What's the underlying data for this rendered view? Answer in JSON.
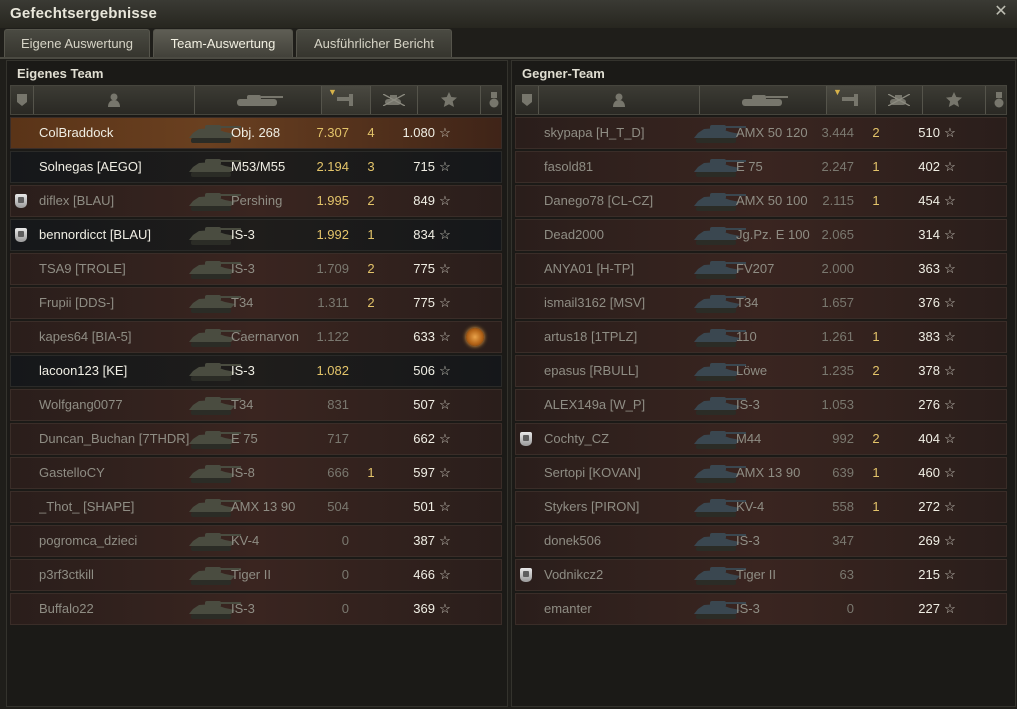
{
  "window": {
    "title": "Gefechtsergebnisse"
  },
  "tabs": [
    {
      "label": "Eigene Auswertung",
      "active": false
    },
    {
      "label": "Team-Auswertung",
      "active": true
    },
    {
      "label": "Ausführlicher Bericht",
      "active": false
    }
  ],
  "columns": [
    "platoon-icon",
    "player-icon",
    "vehicle-icon",
    "xp-icon",
    "kills-icon",
    "star-icon",
    "medal-icon"
  ],
  "own_team": {
    "title": "Eigenes Team",
    "rows": [
      {
        "name": "ColBraddock",
        "vehicle": "Obj. 268",
        "xp": "7.307",
        "kills": "4",
        "score": "1.080",
        "self": true
      },
      {
        "name": "Solnegas [AEGO]",
        "vehicle": "M53/M55",
        "xp": "2.194",
        "kills": "3",
        "score": "715"
      },
      {
        "name": "diflex [BLAU]",
        "vehicle": "Pershing",
        "xp": "1.995",
        "kills": "2",
        "score": "849",
        "platoon": true
      },
      {
        "name": "bennordicct [BLAU]",
        "vehicle": "IS-3",
        "xp": "1.992",
        "kills": "1",
        "score": "834",
        "platoon": true
      },
      {
        "name": "TSA9 [TROLE]",
        "vehicle": "IS-3",
        "xp": "1.709",
        "kills": "2",
        "score": "775"
      },
      {
        "name": "Frupii [DDS-]",
        "vehicle": "T34",
        "xp": "1.311",
        "kills": "2",
        "score": "775"
      },
      {
        "name": "kapes64 [BIA-5]",
        "vehicle": "Caernarvon",
        "xp": "1.122",
        "kills": "",
        "score": "633",
        "medal": true
      },
      {
        "name": "lacoon123 [KE]",
        "vehicle": "IS-3",
        "xp": "1.082",
        "kills": "",
        "score": "506"
      },
      {
        "name": "Wolfgang0077",
        "vehicle": "T34",
        "xp": "831",
        "kills": "",
        "score": "507"
      },
      {
        "name": "Duncan_Buchan [7THDR]",
        "vehicle": "E 75",
        "xp": "717",
        "kills": "",
        "score": "662"
      },
      {
        "name": "GastelloCY",
        "vehicle": "IS-8",
        "xp": "666",
        "kills": "1",
        "score": "597"
      },
      {
        "name": "_Thot_ [SHAPE]",
        "vehicle": "AMX 13 90",
        "xp": "504",
        "kills": "",
        "score": "501"
      },
      {
        "name": "pogromca_dzieci",
        "vehicle": "KV-4",
        "xp": "0",
        "kills": "",
        "score": "387"
      },
      {
        "name": "p3rf3ctkill",
        "vehicle": "Tiger II",
        "xp": "0",
        "kills": "",
        "score": "466"
      },
      {
        "name": "Buffalo22",
        "vehicle": "IS-3",
        "xp": "0",
        "kills": "",
        "score": "369"
      }
    ]
  },
  "enemy_team": {
    "title": "Gegner-Team",
    "rows": [
      {
        "name": "skypapa [H_T_D]",
        "vehicle": "AMX 50 120",
        "xp": "3.444",
        "kills": "2",
        "score": "510"
      },
      {
        "name": "fasold81",
        "vehicle": "E 75",
        "xp": "2.247",
        "kills": "1",
        "score": "402"
      },
      {
        "name": "Danego78 [CL-CZ]",
        "vehicle": "AMX 50 100",
        "xp": "2.115",
        "kills": "1",
        "score": "454"
      },
      {
        "name": "Dead2000",
        "vehicle": "Jg.Pz. E 100",
        "xp": "2.065",
        "kills": "",
        "score": "314"
      },
      {
        "name": "ANYA01 [H-TP]",
        "vehicle": "FV207",
        "xp": "2.000",
        "kills": "",
        "score": "363"
      },
      {
        "name": "ismail3162 [MSV]",
        "vehicle": "T34",
        "xp": "1.657",
        "kills": "",
        "score": "376"
      },
      {
        "name": "artus18 [1TPLZ]",
        "vehicle": "110",
        "xp": "1.261",
        "kills": "1",
        "score": "383"
      },
      {
        "name": "epasus [RBULL]",
        "vehicle": "Löwe",
        "xp": "1.235",
        "kills": "2",
        "score": "378"
      },
      {
        "name": "ALEX149a [W_P]",
        "vehicle": "IS-3",
        "xp": "1.053",
        "kills": "",
        "score": "276"
      },
      {
        "name": "Cochty_CZ",
        "vehicle": "M44",
        "xp": "992",
        "kills": "2",
        "score": "404",
        "platoon": true
      },
      {
        "name": "Sertopi [KOVAN]",
        "vehicle": "AMX 13 90",
        "xp": "639",
        "kills": "1",
        "score": "460"
      },
      {
        "name": "Stykers [PIRON]",
        "vehicle": "KV-4",
        "xp": "558",
        "kills": "1",
        "score": "272"
      },
      {
        "name": "donek506",
        "vehicle": "IS-3",
        "xp": "347",
        "kills": "",
        "score": "269"
      },
      {
        "name": "Vodnikcz2",
        "vehicle": "Tiger II",
        "xp": "63",
        "kills": "",
        "score": "215",
        "platoon": true
      },
      {
        "name": "emanter",
        "vehicle": "IS-3",
        "xp": "0",
        "kills": "",
        "score": "227"
      }
    ]
  }
}
